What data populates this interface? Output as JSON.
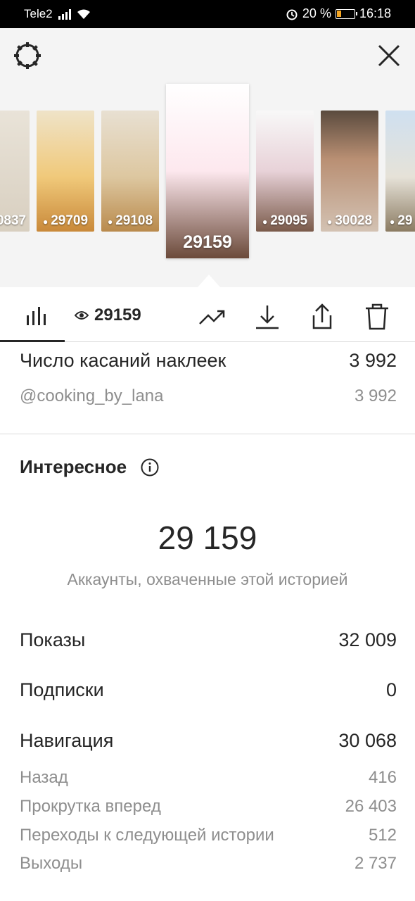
{
  "status_bar": {
    "carrier": "Tele2",
    "battery": "20 %",
    "time": "16:18"
  },
  "thumbnails": [
    {
      "views": "0837"
    },
    {
      "views": "29709"
    },
    {
      "views": "29108"
    },
    {
      "views": "29159",
      "selected": true
    },
    {
      "views": "29095"
    },
    {
      "views": "30028"
    },
    {
      "views": "29"
    }
  ],
  "tabs": {
    "views_count": "29159"
  },
  "sticker_taps": {
    "label": "Число касаний наклеек",
    "value": "3 992",
    "items": [
      {
        "label": "@cooking_by_lana",
        "value": "3 992"
      }
    ]
  },
  "discovery": {
    "title": "Интересное",
    "reach_value": "29 159",
    "reach_caption": "Аккаунты, охваченные этой историей",
    "impressions_label": "Показы",
    "impressions_value": "32 009",
    "follows_label": "Подписки",
    "follows_value": "0",
    "navigation_label": "Навигация",
    "navigation_value": "30 068",
    "navigation_items": [
      {
        "label": "Назад",
        "value": "416"
      },
      {
        "label": "Прокрутка вперед",
        "value": "26 403"
      },
      {
        "label": "Переходы к следующей истории",
        "value": "512"
      },
      {
        "label": "Выходы",
        "value": "2 737"
      }
    ]
  },
  "colors": {
    "text": "#262626",
    "muted": "#8e8e8e",
    "divider": "#dbdbdb",
    "header_bg": "#f4f4f4"
  }
}
